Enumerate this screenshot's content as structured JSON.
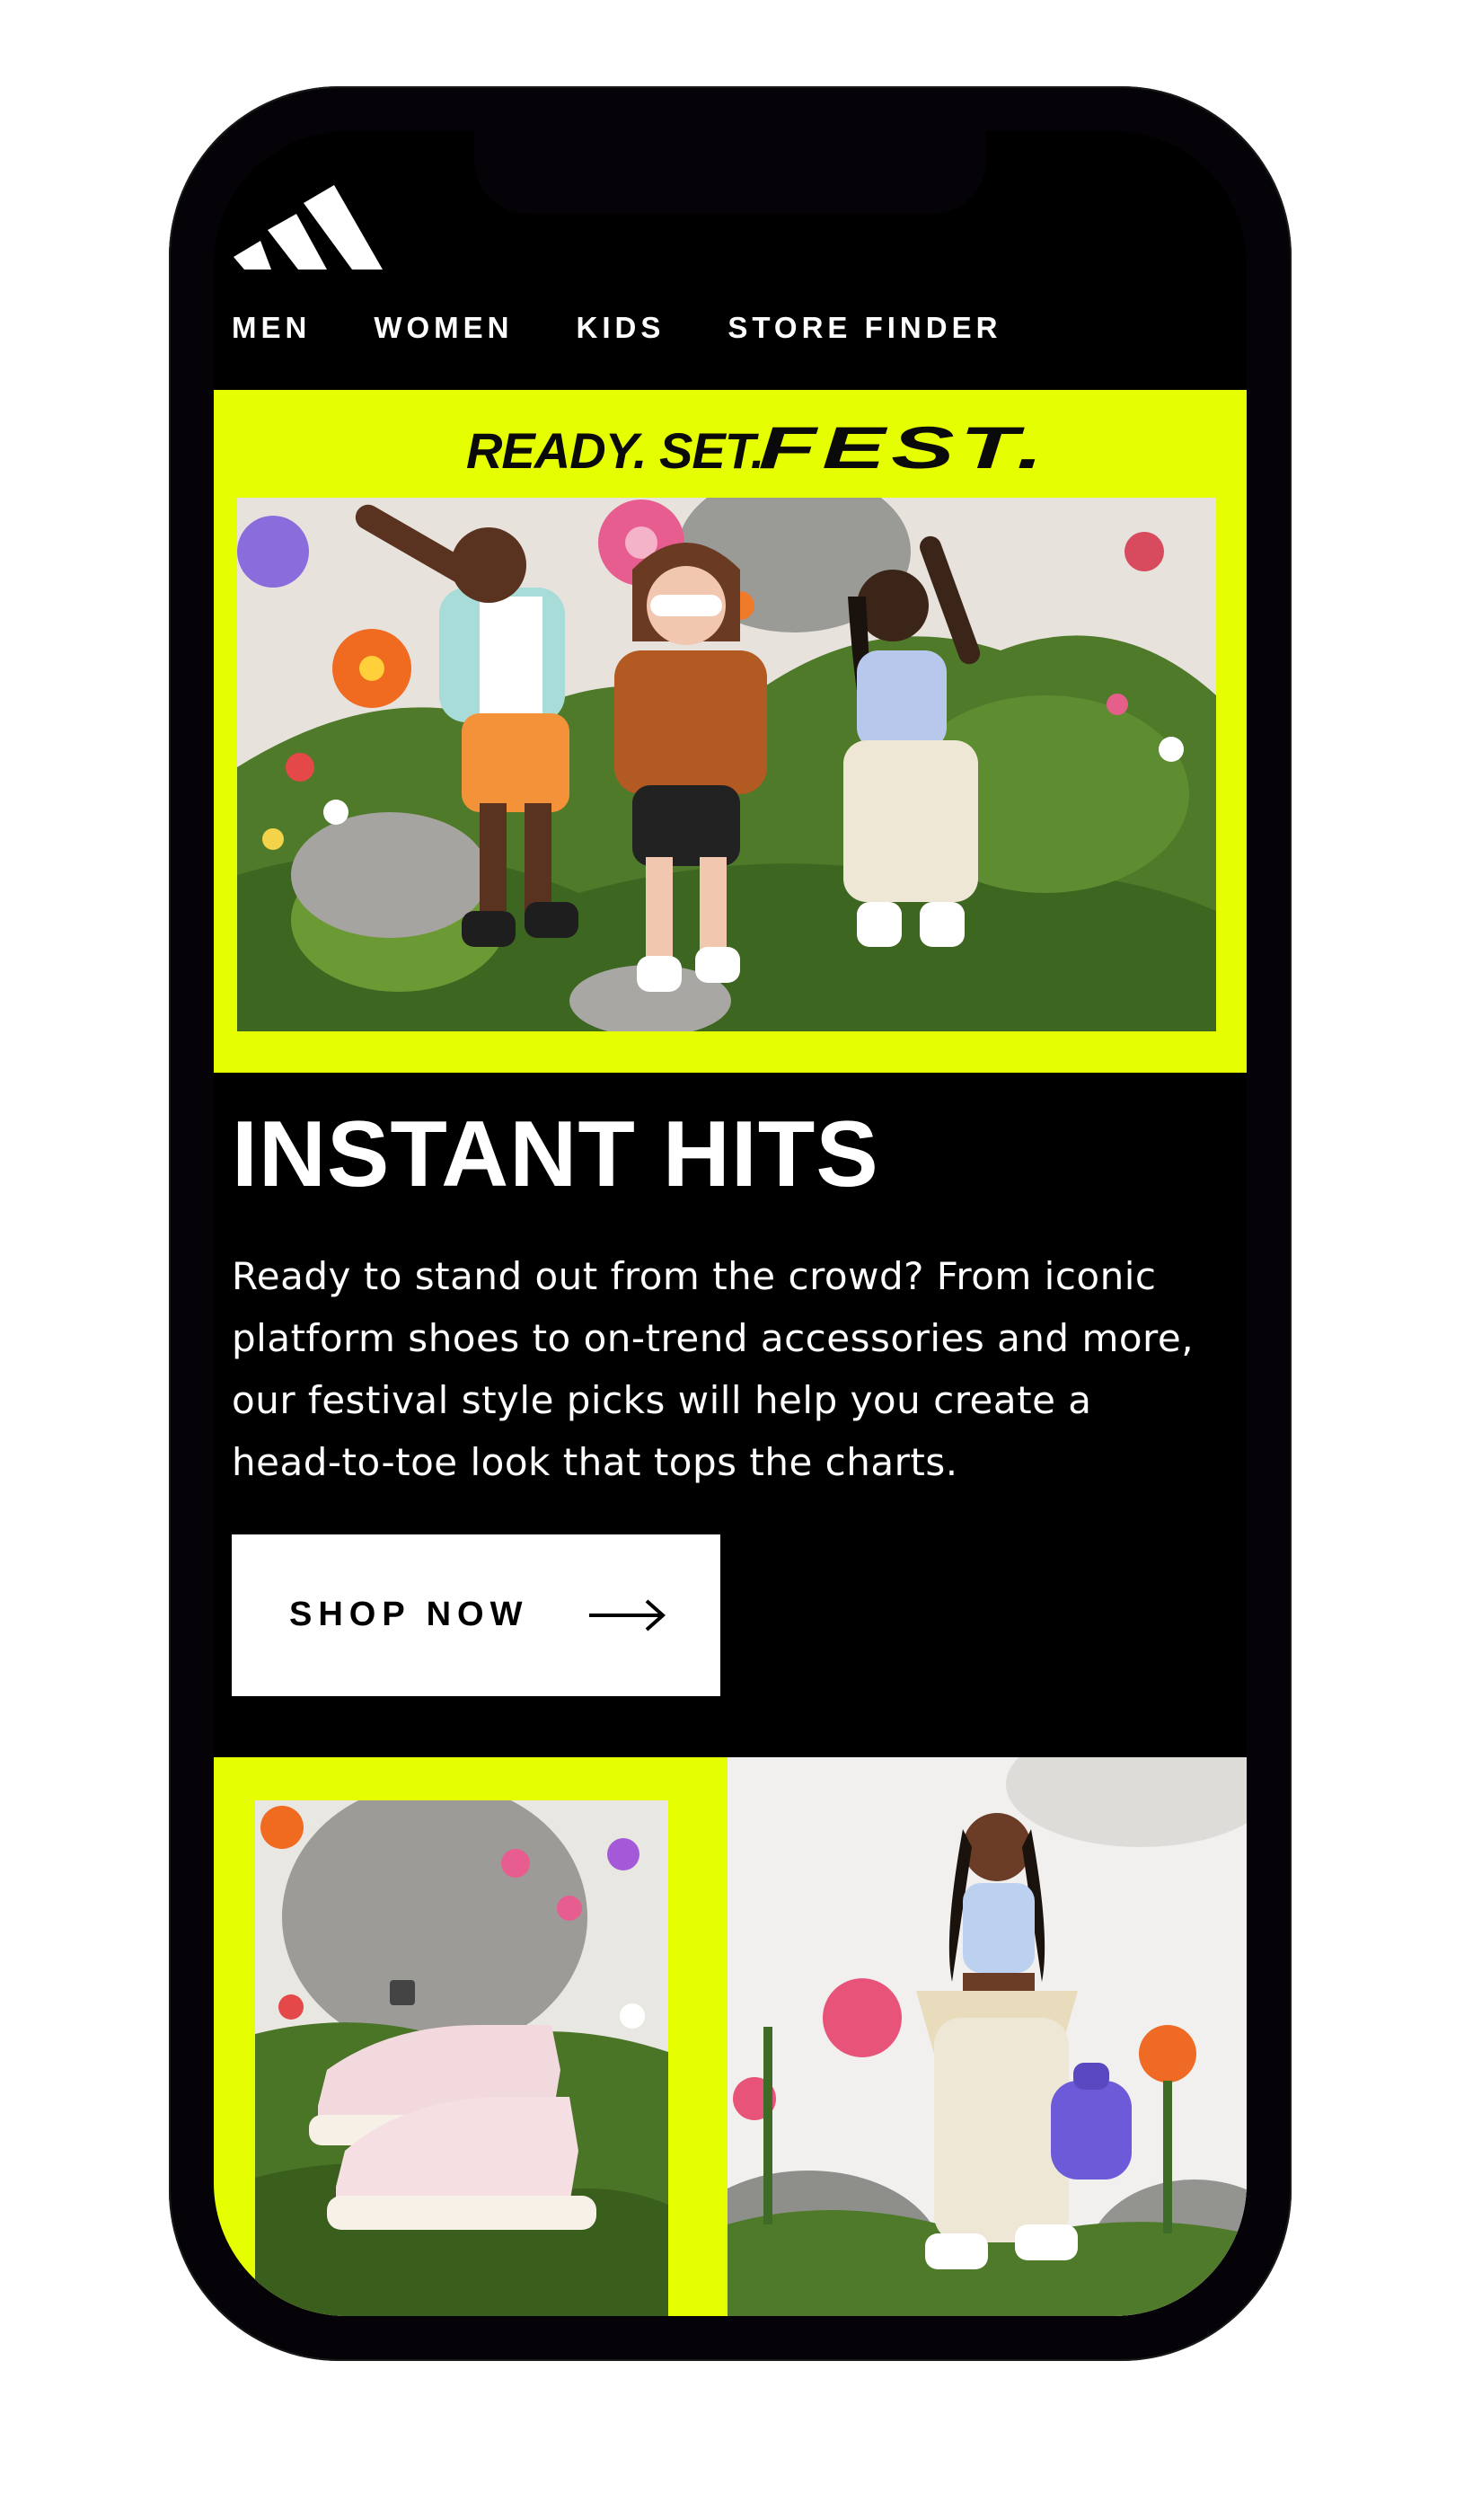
{
  "brand": {
    "logo_icon": "adidas-three-stripes-logo",
    "accent_color": "#e6ff00",
    "background_color": "#000000"
  },
  "nav": {
    "items": [
      {
        "label": "MEN"
      },
      {
        "label": "WOMEN"
      },
      {
        "label": "KIDS"
      },
      {
        "label": "STORE FINDER"
      }
    ]
  },
  "hero": {
    "title_part1": "READY. SET.",
    "title_part2": "FEST.",
    "image": "three-friends-posing-in-flower-garden-photo"
  },
  "main": {
    "headline": "INSTANT HITS",
    "body": "Ready to stand out from the crowd? From iconic platform shoes to on-trend accessories and more, our festival style picks will help you create a head-to-toe look that tops the charts.",
    "cta_label": "SHOP NOW",
    "cta_icon": "arrow-right-icon"
  },
  "tiles": [
    {
      "image": "pink-platform-sneakers-on-moss-photo"
    },
    {
      "image": "woman-in-crop-top-with-backpack-photo"
    }
  ]
}
